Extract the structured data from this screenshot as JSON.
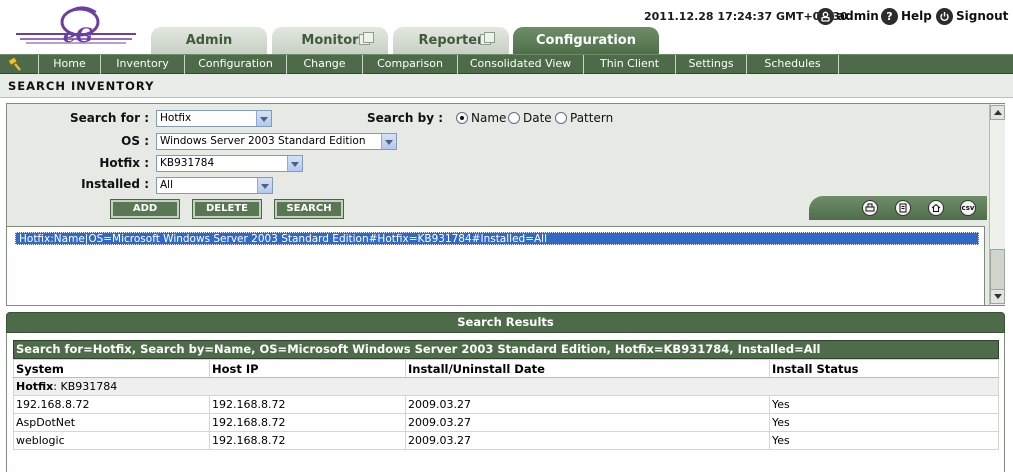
{
  "header": {
    "datetime": "2011.12.28 17:24:37 GMT+05:30",
    "user_label": "admin",
    "help_label": "Help",
    "signout_label": "Signout",
    "logo_text": "eG"
  },
  "tabs": [
    {
      "label": "Admin"
    },
    {
      "label": "Monitor"
    },
    {
      "label": "Reporter"
    },
    {
      "label": "Configuration"
    }
  ],
  "subnav": [
    {
      "label": "Home"
    },
    {
      "label": "Inventory"
    },
    {
      "label": "Configuration"
    },
    {
      "label": "Change"
    },
    {
      "label": "Comparison"
    },
    {
      "label": "Consolidated View"
    },
    {
      "label": "Thin Client"
    },
    {
      "label": "Settings"
    },
    {
      "label": "Schedules"
    }
  ],
  "page_title": "SEARCH INVENTORY",
  "form": {
    "search_for_label": "Search for :",
    "search_for_value": "Hotfix",
    "os_label": "OS :",
    "os_value": "Windows Server 2003 Standard Edition",
    "hotfix_label": "Hotfix :",
    "hotfix_value": "KB931784",
    "installed_label": "Installed :",
    "installed_value": "All",
    "search_by_label": "Search by :",
    "search_by_options": [
      "Name",
      "Date",
      "Pattern"
    ],
    "search_by_selected": "Name"
  },
  "buttons": {
    "add": "ADD",
    "delete": "DELETE",
    "search": "SEARCH"
  },
  "export_icons": [
    "print-icon",
    "pdf-icon",
    "home-icon",
    "csv-icon"
  ],
  "export_csv_text": "csv",
  "criteria_list": [
    "Hotfix:Name|OS=Microsoft Windows Server 2003 Standard Edition#Hotfix=KB931784#Installed=All"
  ],
  "results": {
    "title": "Search Results",
    "query": "Search for=Hotfix, Search by=Name, OS=Microsoft Windows Server 2003 Standard Edition, Hotfix=KB931784, Installed=All",
    "columns": [
      "System",
      "Host IP",
      "Install/Uninstall Date",
      "Install Status"
    ],
    "group_label": "Hotfix",
    "group_value": ": KB931784",
    "rows": [
      {
        "system": "192.168.8.72",
        "host_ip": "192.168.8.72",
        "date": "2009.03.27",
        "status": "Yes"
      },
      {
        "system": "AspDotNet",
        "host_ip": "192.168.8.72",
        "date": "2009.03.27",
        "status": "Yes"
      },
      {
        "system": "weblogic",
        "host_ip": "192.168.8.72",
        "date": "2009.03.27",
        "status": "Yes"
      }
    ]
  },
  "colors": {
    "nav_green": "#4e6b49",
    "selected_blue": "#316ac5",
    "panel_bg": "#e6e9e4"
  }
}
